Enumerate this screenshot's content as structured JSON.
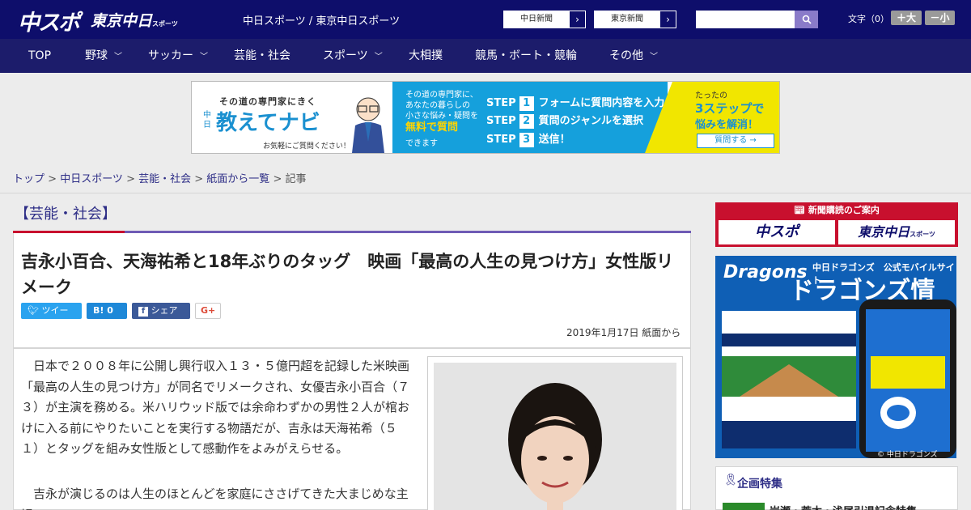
{
  "header": {
    "logo_chuspo": "中スポ",
    "logo_tokyo": "東京中日",
    "logo_tokyo_small": "スポーツ",
    "site_title": "中日スポーツ / 東京中日スポーツ",
    "btn_chunichi": "中日新聞",
    "btn_tokyo": "東京新聞",
    "search_placeholder": "",
    "font_size_label": "文字（0）",
    "font_large": "＋大",
    "font_small": "－小"
  },
  "nav": [
    {
      "label": "TOP"
    },
    {
      "label": "野球"
    },
    {
      "label": "サッカー"
    },
    {
      "label": "芸能・社会"
    },
    {
      "label": "スポーツ"
    },
    {
      "label": "大相撲"
    },
    {
      "label": "競馬・ボート・競輪"
    },
    {
      "label": "その他"
    }
  ],
  "banner": {
    "catch": "その道の専門家にきく",
    "brand_small": "中日",
    "brand": "教えてナビ",
    "note": "お気軽にご質問ください！",
    "desc1": "その道の専門家に、",
    "desc2": "あなたの暮らしの",
    "desc3": "小さな悩み・疑問を",
    "free": "無料で質問",
    "can": "できます",
    "step": "STEP",
    "step1": "フォームに質問内容を入力",
    "step2": "質問のジャンルを選択",
    "step3": "送信！",
    "right1": "たったの",
    "right2": "3ステップで",
    "right3": "悩みを解消！",
    "cta": "質問する →"
  },
  "breadcrumb": {
    "home": "トップ",
    "site": "中日スポーツ",
    "cat": "芸能・社会",
    "list": "紙面から一覧",
    "current": "記事",
    "sep": " > "
  },
  "category": "【芸能・社会】",
  "article": {
    "headline": "吉永小百合、天海祐希と18年ぶりのタッグ　映画「最高の人生の見つけ方」女性版リメーク",
    "share_tweet": "ツイート",
    "share_hatena": "B! 0",
    "share_fb": "シェア 0",
    "share_gplus": "G+",
    "date": "2019年1月17日 紙面から",
    "para1": "日本で２００８年に公開し興行収入１３・５億円超を記録した米映画「最高の人生の見つけ方」が同名でリメークされ、女優吉永小百合（７３）が主演を務める。米ハリウッド版では余命わずかの男性２人が棺おけに入る前にやりたいことを実行する物語だが、吉永は天海祐希（５１）とタッグを組み女性版として感動作をよみがえらせる。",
    "para2": "吉永が演じるのは人生のほとんどを家庭にささげてきた大まじめな主婦。"
  },
  "sidebar": {
    "subscribe_title": "新聞購読のご案内",
    "sub_logo1": "中スポ",
    "sub_logo2": "東京中日",
    "sub_logo2_small": "スポーツ",
    "dragons_logo": "Dragons",
    "dragons_sub": "中日ドラゴンズ　公式モバイルサイト",
    "dragons_big": "ドラゴンズ情報",
    "dragons_copy": "© 中日ドラゴンズ",
    "special_title": "企画特集",
    "special_item": "岩瀬・荒木・浅尾引退記念特集"
  },
  "colors": {
    "header_bg": "#0e0e6b",
    "nav_bg": "#1c1c6b",
    "accent_red": "#c8102e",
    "accent_purple": "#6f5bb5"
  }
}
